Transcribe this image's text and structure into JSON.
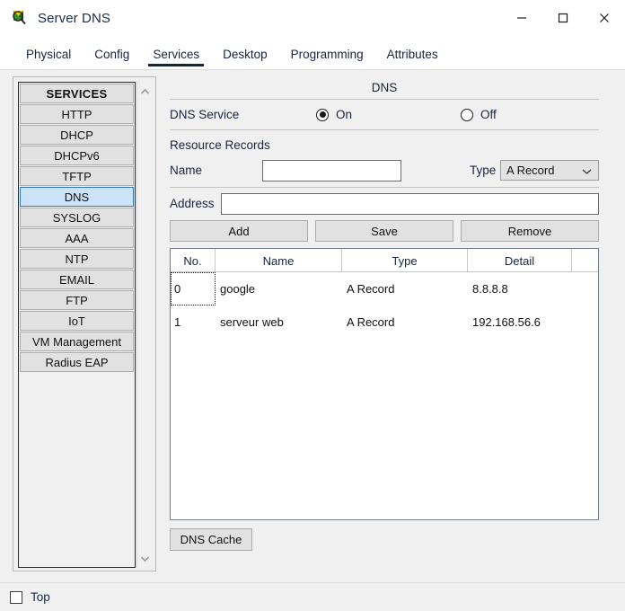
{
  "window": {
    "title": "Server DNS",
    "icon": "packet-tracer-icon",
    "minimize": "—",
    "maximize": "□",
    "close": "✕"
  },
  "tabs": [
    {
      "label": "Physical",
      "active": false
    },
    {
      "label": "Config",
      "active": false
    },
    {
      "label": "Services",
      "active": true
    },
    {
      "label": "Desktop",
      "active": false
    },
    {
      "label": "Programming",
      "active": false
    },
    {
      "label": "Attributes",
      "active": false
    }
  ],
  "sidebar": {
    "items": [
      {
        "label": "SERVICES",
        "header": true,
        "selected": false
      },
      {
        "label": "HTTP",
        "header": false,
        "selected": false
      },
      {
        "label": "DHCP",
        "header": false,
        "selected": false
      },
      {
        "label": "DHCPv6",
        "header": false,
        "selected": false
      },
      {
        "label": "TFTP",
        "header": false,
        "selected": false
      },
      {
        "label": "DNS",
        "header": false,
        "selected": true
      },
      {
        "label": "SYSLOG",
        "header": false,
        "selected": false
      },
      {
        "label": "AAA",
        "header": false,
        "selected": false
      },
      {
        "label": "NTP",
        "header": false,
        "selected": false
      },
      {
        "label": "EMAIL",
        "header": false,
        "selected": false
      },
      {
        "label": "FTP",
        "header": false,
        "selected": false
      },
      {
        "label": "IoT",
        "header": false,
        "selected": false
      },
      {
        "label": "VM Management",
        "header": false,
        "selected": false
      },
      {
        "label": "Radius EAP",
        "header": false,
        "selected": false
      }
    ]
  },
  "main": {
    "title": "DNS",
    "service": {
      "label": "DNS Service",
      "on_label": "On",
      "off_label": "Off",
      "value": "On"
    },
    "resource_records": {
      "section_label": "Resource Records",
      "name_label": "Name",
      "name_value": "",
      "name_placeholder": "",
      "type_label": "Type",
      "type_value": "A Record",
      "address_label": "Address",
      "address_value": "",
      "address_placeholder": ""
    },
    "buttons": {
      "add": "Add",
      "save": "Save",
      "remove": "Remove"
    },
    "table": {
      "columns": [
        "No.",
        "Name",
        "Type",
        "Detail",
        ""
      ],
      "rows": [
        {
          "no": "0",
          "name": "google",
          "type": "A Record",
          "detail": "8.8.8.8",
          "focused": true
        },
        {
          "no": "1",
          "name": "serveur web",
          "type": "A Record",
          "detail": "192.168.56.6",
          "focused": false
        }
      ]
    },
    "cache_button": "DNS Cache"
  },
  "footer": {
    "top_label": "Top",
    "top_checked": false
  },
  "colors": {
    "accent": "#16243f",
    "selection": "#cce3f7",
    "selection_border": "#2f78bd",
    "panel": "#f0f0f0",
    "button": "#e1e1e1"
  }
}
